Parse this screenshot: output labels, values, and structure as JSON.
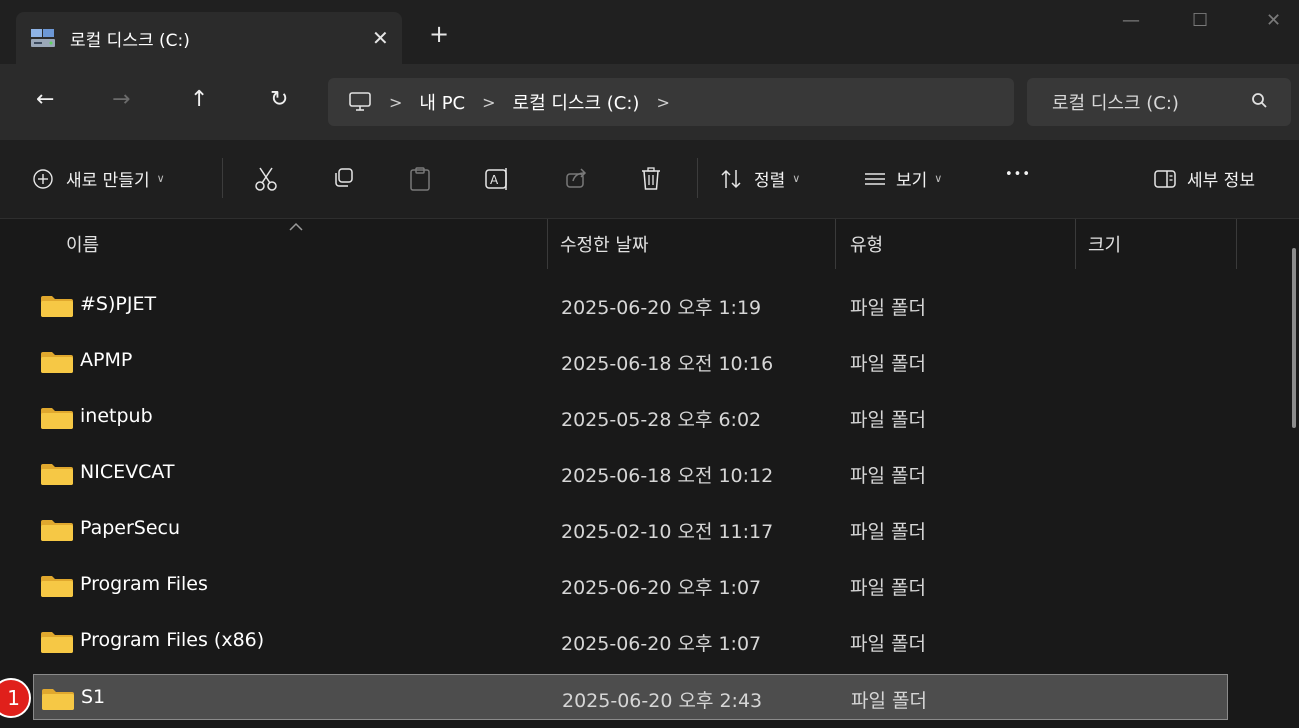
{
  "tab": {
    "title": "로컬 디스크 (C:)",
    "close_glyph": "✕",
    "new_tab_glyph": "+"
  },
  "window": {
    "minimize_glyph": "—",
    "maximize_glyph": "☐",
    "close_glyph": "✕"
  },
  "nav": {
    "back_glyph": "←",
    "forward_glyph": "→",
    "up_glyph": "↑",
    "refresh_glyph": "↻"
  },
  "address": {
    "separator": ">",
    "crumbs": [
      "내 PC",
      "로컬 디스크 (C:)"
    ]
  },
  "search": {
    "placeholder": "로컬 디스크 (C:)"
  },
  "toolbar": {
    "new_label": "새로 만들기",
    "sort_label": "정렬",
    "view_label": "보기",
    "more_glyph": "•••",
    "details_label": "세부 정보"
  },
  "columns": {
    "name": "이름",
    "date": "수정한 날짜",
    "type": "유형",
    "size": "크기"
  },
  "files": [
    {
      "name": "#S)PJET",
      "date": "2025-06-20 오후 1:19",
      "type": "파일 폴더",
      "selected": false
    },
    {
      "name": "APMP",
      "date": "2025-06-18 오전 10:16",
      "type": "파일 폴더",
      "selected": false
    },
    {
      "name": "inetpub",
      "date": "2025-05-28 오후 6:02",
      "type": "파일 폴더",
      "selected": false
    },
    {
      "name": "NICEVCAT",
      "date": "2025-06-18 오전 10:12",
      "type": "파일 폴더",
      "selected": false
    },
    {
      "name": "PaperSecu",
      "date": "2025-02-10 오전 11:17",
      "type": "파일 폴더",
      "selected": false
    },
    {
      "name": "Program Files",
      "date": "2025-06-20 오후 1:07",
      "type": "파일 폴더",
      "selected": false
    },
    {
      "name": "Program Files (x86)",
      "date": "2025-06-20 오후 1:07",
      "type": "파일 폴더",
      "selected": false
    },
    {
      "name": "S1",
      "date": "2025-06-20 오후 2:43",
      "type": "파일 폴더",
      "selected": true
    }
  ],
  "marker": {
    "label": "1"
  },
  "colors": {
    "folder": "#f6c845",
    "folder_back": "#e0a82e",
    "accent_red": "#e0201b",
    "selection": "#4d4d4d"
  }
}
